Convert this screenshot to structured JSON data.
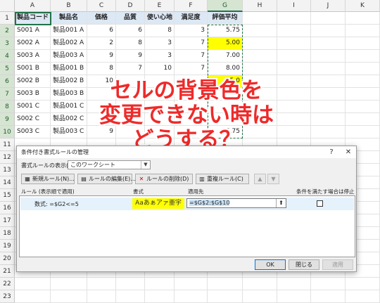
{
  "sheet": {
    "columns": [
      "A",
      "B",
      "C",
      "D",
      "E",
      "F",
      "G",
      "H",
      "I",
      "J",
      "K"
    ],
    "rows": [
      "1",
      "2",
      "3",
      "4",
      "5",
      "6",
      "7",
      "8",
      "9",
      "10",
      "11",
      "12",
      "13",
      "14",
      "15",
      "16",
      "17",
      "18",
      "19",
      "20",
      "21",
      "22",
      "23"
    ],
    "headers": [
      "製品コード",
      "製品名",
      "価格",
      "品質",
      "使い心地",
      "満足度",
      "評価平均"
    ],
    "data": [
      [
        "S001 A",
        "製品001 A",
        "6",
        "6",
        "8",
        "3",
        "5.75"
      ],
      [
        "S002 A",
        "製品002 A",
        "2",
        "8",
        "3",
        "7",
        "5.00"
      ],
      [
        "S003 A",
        "製品003 A",
        "9",
        "9",
        "3",
        "7",
        "7.00"
      ],
      [
        "S001 B",
        "製品001 B",
        "8",
        "7",
        "10",
        "7",
        "8.00"
      ],
      [
        "S002 B",
        "製品002 B",
        "10",
        "",
        "",
        "",
        "5.0"
      ],
      [
        "S003 B",
        "製品003 B",
        "",
        "",
        "",
        "",
        ""
      ],
      [
        "S001 C",
        "製品001 C",
        "",
        "",
        "",
        "",
        ""
      ],
      [
        "S002 C",
        "製品002 C",
        "",
        "",
        "",
        "",
        ""
      ],
      [
        "S003 C",
        "製品003 C",
        "9",
        "",
        "",
        "",
        "5.75"
      ]
    ],
    "highlight_color": "#ffff00"
  },
  "overlay": {
    "lines": [
      "セルの背景色を",
      "変更できない時は",
      "どうする？"
    ],
    "color": "#ee2a2a"
  },
  "dialog": {
    "title": "条件付き書式ルールの管理",
    "help_icon": "?",
    "close_icon": "✕",
    "show_label": "書式ルールの表示(S):",
    "show_value": "このワークシート",
    "buttons": {
      "new_rule": "新規ルール(N)...",
      "edit_rule": "ルールの編集(E)...",
      "delete_rule": "ルールの削除(D)",
      "duplicate_rule": "重複ルール(C)"
    },
    "columns": {
      "rule": "ルール (表示順で適用)",
      "format": "書式",
      "applies_to": "適用先",
      "stop_if_true": "条件を満たす場合は停止"
    },
    "rule_row": {
      "rule": "数式: =$G2<=5",
      "format_preview": "Aaあぁアァ亜宇",
      "applies_to": "=$G$2:$G$10",
      "stop_checked": false
    },
    "footer": {
      "ok": "OK",
      "close": "閉じる",
      "apply": "適用"
    }
  }
}
